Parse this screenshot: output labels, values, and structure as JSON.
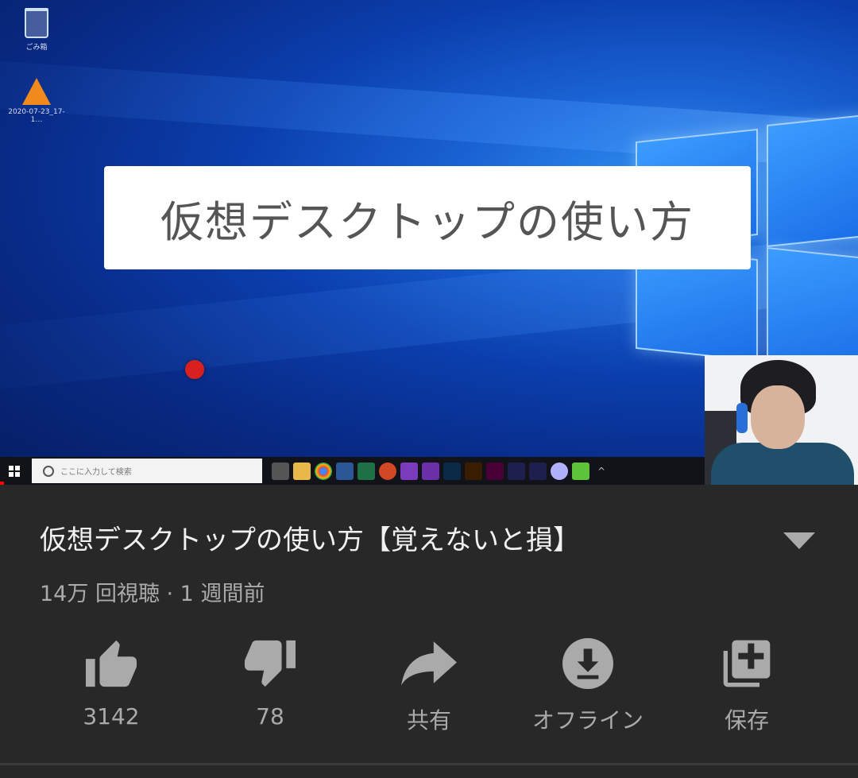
{
  "video": {
    "overlay_title": "仮想デスクトップの使い方",
    "desktop_icons": [
      {
        "label": "ごみ箱",
        "icon": "recycle-bin-icon"
      },
      {
        "label": "2020-07-23_17-1…",
        "icon": "vlc-icon"
      }
    ],
    "taskbar": {
      "search_placeholder": "ここに入力して検索",
      "tray_symbol": "^"
    },
    "progress_fraction": 0.005,
    "colors": {
      "progress": "#ff0000",
      "desktop_blue": "#0b3fae"
    }
  },
  "info": {
    "title": "仮想デスクトップの使い方【覚えないと損】",
    "meta": "14万 回視聴 · 1 週間前"
  },
  "actions": [
    {
      "id": "like",
      "icon": "thumbs-up-icon",
      "label": "3142"
    },
    {
      "id": "dislike",
      "icon": "thumbs-down-icon",
      "label": "78"
    },
    {
      "id": "share",
      "icon": "share-icon",
      "label": "共有"
    },
    {
      "id": "download",
      "icon": "download-icon",
      "label": "オフライン"
    },
    {
      "id": "save",
      "icon": "playlist-add-icon",
      "label": "保存"
    }
  ]
}
